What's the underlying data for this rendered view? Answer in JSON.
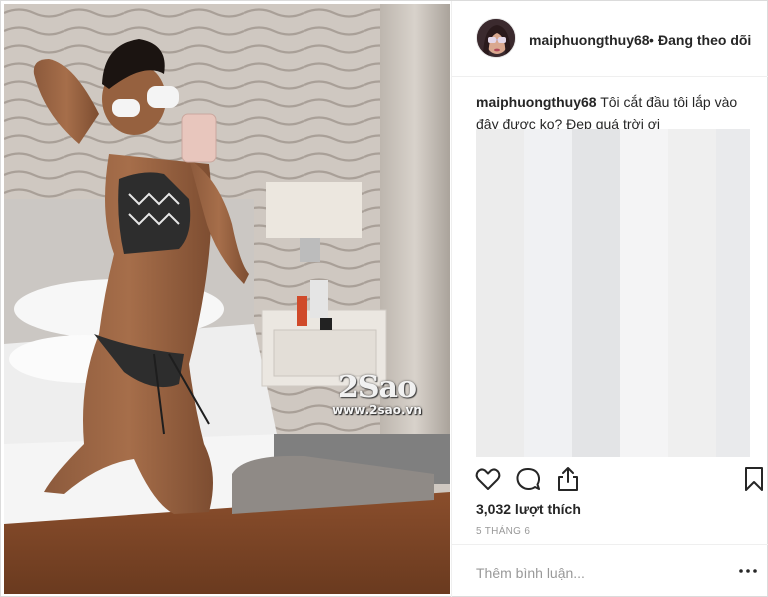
{
  "post": {
    "username": "maiphuongthuy68",
    "separator": "•",
    "follow_status": "Đang theo dõi",
    "caption_user": "maiphuongthuy68",
    "caption_text": "Tôi cắt đầu tôi lắp vào đây được ko? Đẹp quá trời ơi",
    "likes": "3,032 lượt thích",
    "date": "5 THÁNG 6",
    "comment_placeholder": "Thêm bình luận..."
  },
  "watermark": {
    "logo": "2Sao",
    "url": "www.2sao.vn"
  },
  "icons": {
    "like": "heart-icon",
    "comment": "comment-bubble-icon",
    "share": "share-icon",
    "save": "bookmark-icon",
    "more": "ellipsis-icon"
  },
  "colors": {
    "text": "#262626",
    "muted": "#999999",
    "border": "#efefef"
  }
}
